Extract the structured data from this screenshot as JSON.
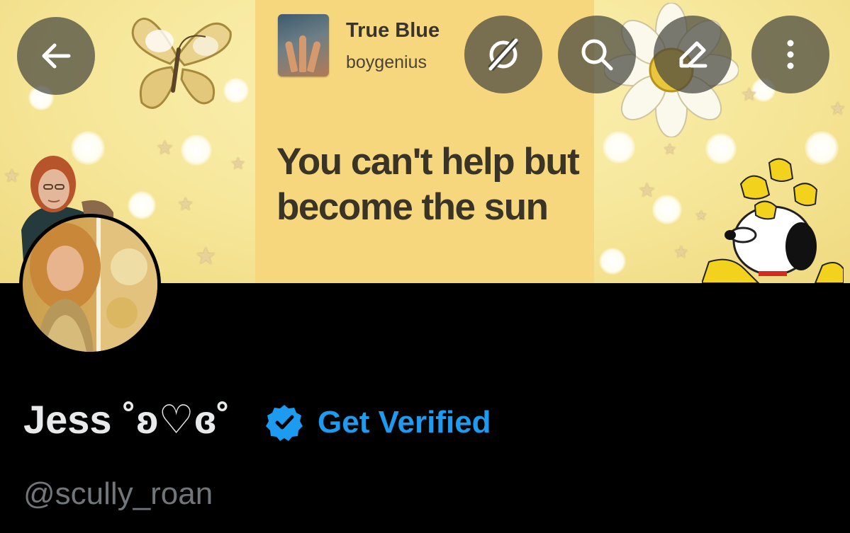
{
  "header": {
    "back_icon": "arrow-left-icon",
    "actions": [
      {
        "icon": "disconnect-icon"
      },
      {
        "icon": "search-icon"
      },
      {
        "icon": "edit-icon"
      },
      {
        "icon": "more-vertical-icon"
      }
    ]
  },
  "banner": {
    "song_title": "True Blue",
    "song_artist": "boygenius",
    "lyric": "You can't help but become the sun"
  },
  "profile": {
    "display_name": "Jess ˚ʚ♡ɞ˚",
    "verified_icon": "verified-badge-icon",
    "get_verified_label": "Get Verified",
    "handle": "@scully_roan"
  },
  "colors": {
    "accent": "#1d9bf0",
    "background": "#000000",
    "name_text": "#e7e9ea",
    "handle_text": "#71767b",
    "button_overlay": "#46463e"
  }
}
